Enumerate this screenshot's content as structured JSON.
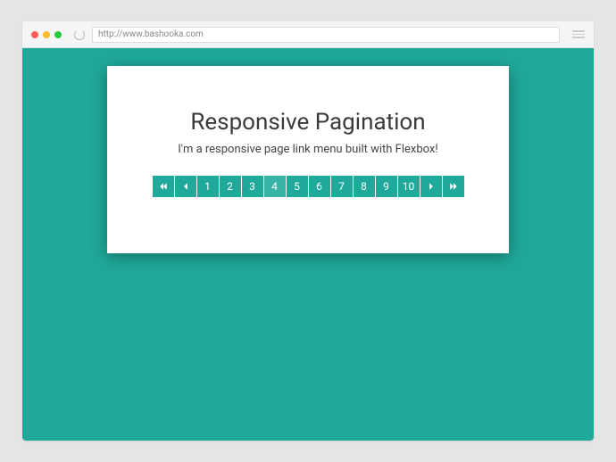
{
  "browser": {
    "url": "http://www.bashooka.com"
  },
  "content": {
    "title": "Responsive Pagination",
    "subtitle": "I'm a responsive page link menu built with Flexbox!"
  },
  "pagination": {
    "first_label": "«",
    "prev_label": "‹",
    "next_label": "›",
    "last_label": "»",
    "pages": [
      "1",
      "2",
      "3",
      "4",
      "5",
      "6",
      "7",
      "8",
      "9",
      "10"
    ],
    "active_page": "4"
  },
  "colors": {
    "accent": "#1fa99a",
    "accent_light": "#37b4a6"
  }
}
